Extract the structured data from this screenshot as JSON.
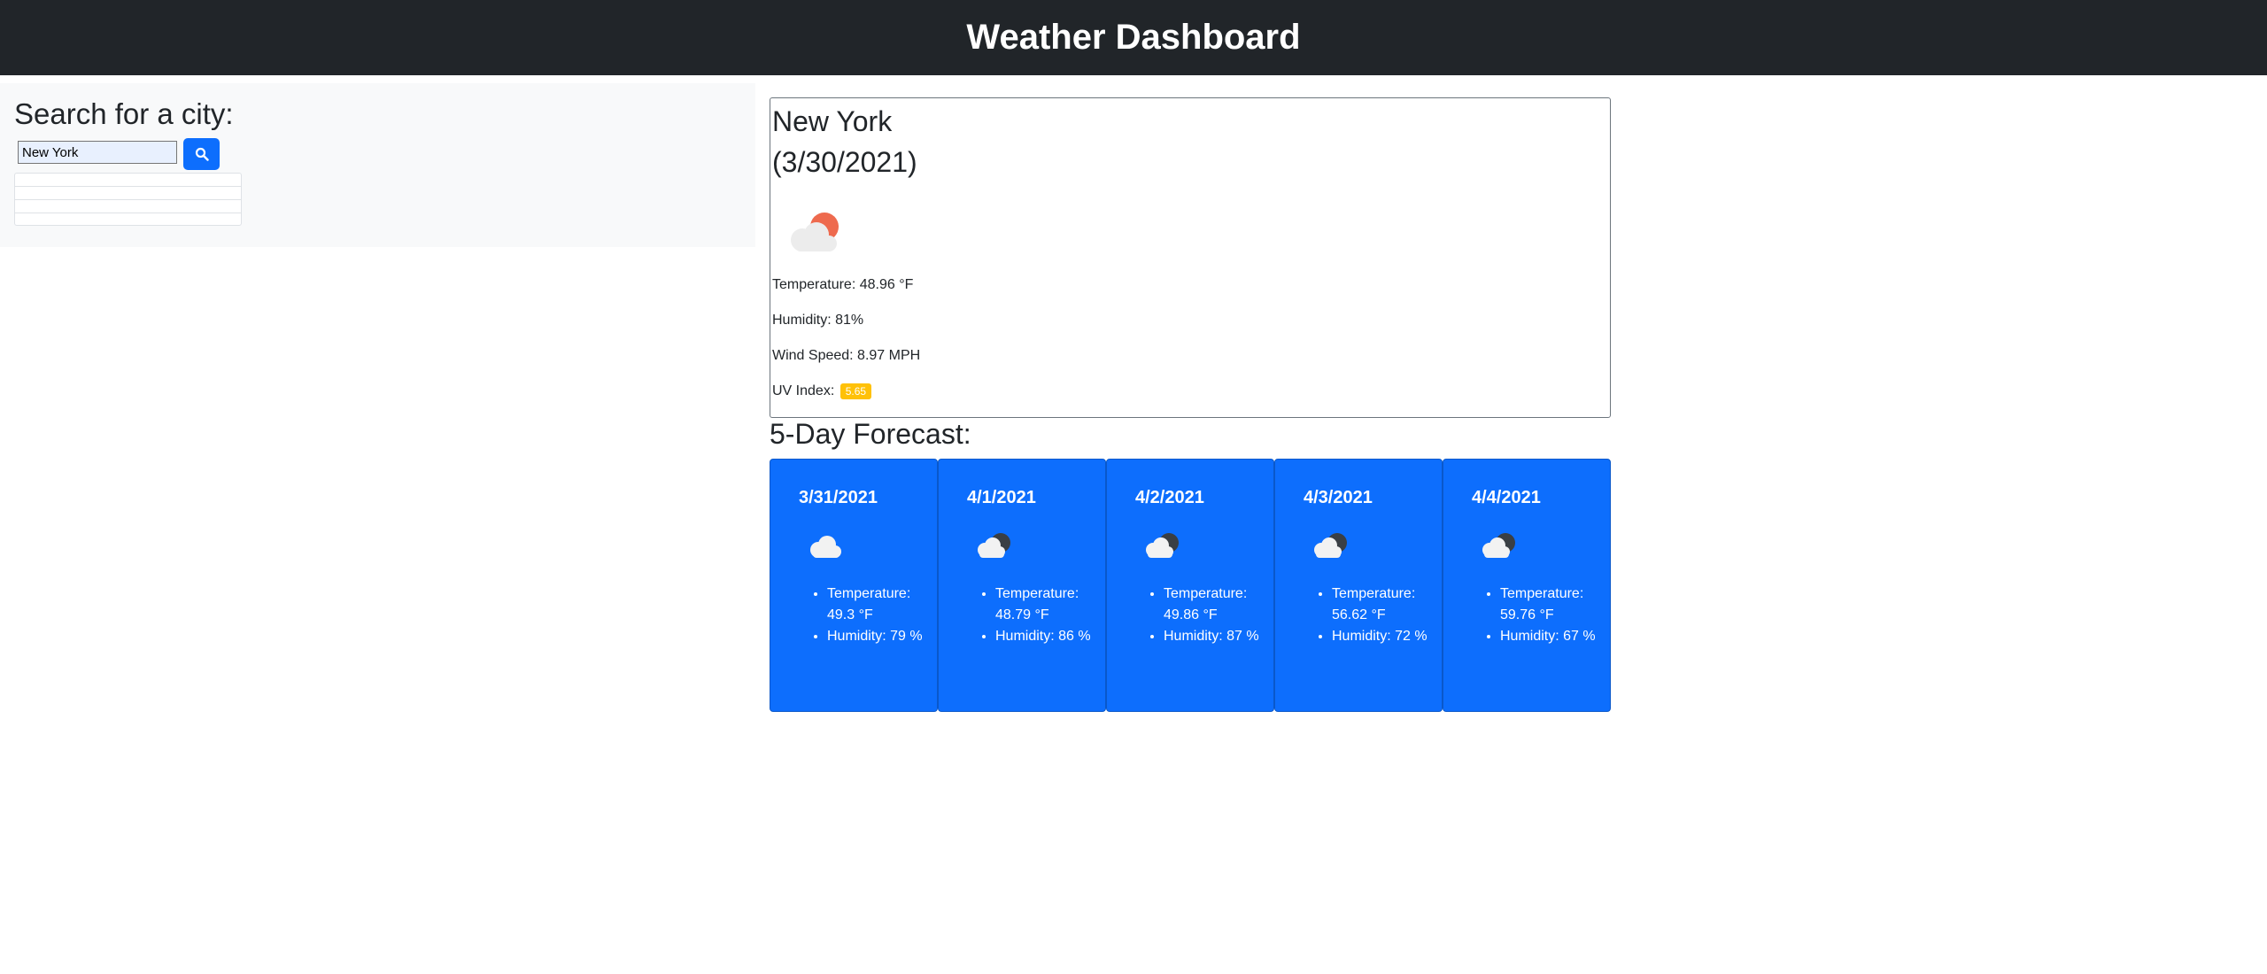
{
  "header": {
    "title": "Weather Dashboard"
  },
  "search": {
    "title": "Search for a city:",
    "input_value": "New York",
    "history_items": [
      "",
      "",
      "",
      ""
    ]
  },
  "current": {
    "city": "New York",
    "date": "(3/30/2021)",
    "icon": "partly-cloudy-sun-icon",
    "temperature": "Temperature: 48.96 °F",
    "humidity": "Humidity: 81%",
    "wind": "Wind Speed: 8.97 MPH",
    "uv_label": "UV Index:",
    "uv_value": "5.65",
    "uv_color": "#ffc107"
  },
  "forecast": {
    "title": "5-Day Forecast:",
    "days": [
      {
        "date": "3/31/2021",
        "icon": "cloud-icon",
        "temp": "Temperature: 49.3 °F",
        "humidity": "Humidity: 79 %"
      },
      {
        "date": "4/1/2021",
        "icon": "cloud-moon-icon",
        "temp": "Temperature: 48.79 °F",
        "humidity": "Humidity: 86 %"
      },
      {
        "date": "4/2/2021",
        "icon": "cloud-moon-icon",
        "temp": "Temperature: 49.86 °F",
        "humidity": "Humidity: 87 %"
      },
      {
        "date": "4/3/2021",
        "icon": "cloud-moon-icon",
        "temp": "Temperature: 56.62 °F",
        "humidity": "Humidity: 72 %"
      },
      {
        "date": "4/4/2021",
        "icon": "cloud-moon-icon",
        "temp": "Temperature: 59.76 °F",
        "humidity": "Humidity: 67 %"
      }
    ]
  },
  "colors": {
    "header_bg": "#212529",
    "accent": "#0d6efd",
    "uv_moderate": "#ffc107"
  }
}
